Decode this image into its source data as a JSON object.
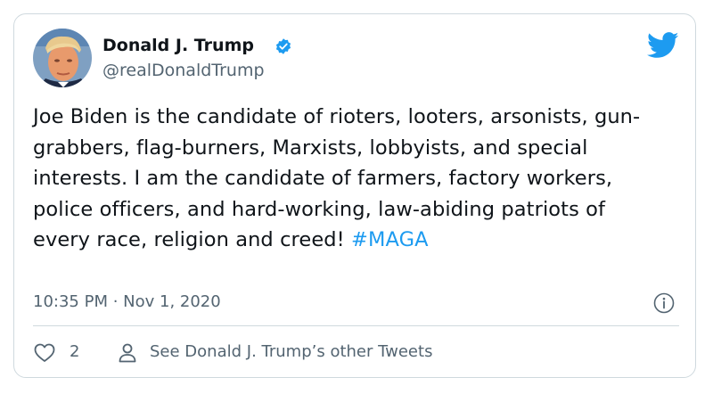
{
  "author": {
    "name": "Donald J. Trump",
    "handle": "@realDonaldTrump"
  },
  "tweet": {
    "text": "Joe Biden is the candidate of rioters, looters, arsonists, gun-grabbers, flag-burners, Marxists, lobbyists, and special interests. I am the candidate of farmers, factory workers, police officers, and hard-working, law-abiding patriots of every race, religion and creed! ",
    "hashtag": "#MAGA",
    "timestamp": "10:35 PM · Nov 1, 2020"
  },
  "actions": {
    "like_count": "2",
    "see_other_label": "See Donald J. Trump’s other Tweets"
  },
  "icons": {
    "brand": "twitter-bird-icon",
    "verified": "verified-badge-icon",
    "info": "info-icon",
    "like": "heart-icon",
    "profile": "person-icon"
  },
  "colors": {
    "accent": "#1d9bf0",
    "text": "#0f1419",
    "muted": "#536471",
    "border": "#cfd9de"
  }
}
